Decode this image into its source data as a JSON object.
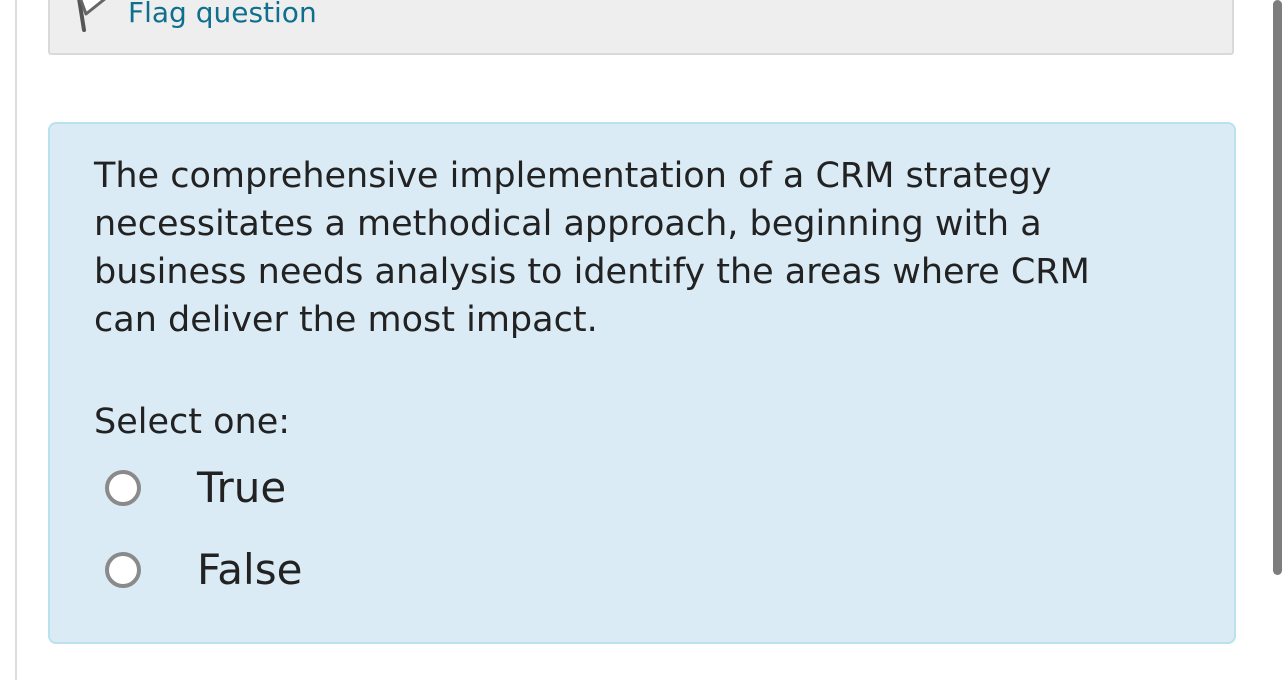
{
  "info": {
    "flag_label": "Flag question"
  },
  "question": {
    "text": "The comprehensive implementation of a CRM strategy necessitates a methodical approach, beginning with a business needs analysis to identify the areas where CRM can deliver the most impact.",
    "prompt": "Select one:",
    "options": [
      {
        "label": "True"
      },
      {
        "label": "False"
      }
    ]
  },
  "icons": {
    "flag": "flag-icon",
    "radio": "radio-unchecked-icon"
  },
  "colors": {
    "link": "#0f6f8f",
    "panel_background": "#daebf5",
    "panel_border": "#b9e2ee",
    "info_background": "#eeeeee"
  }
}
